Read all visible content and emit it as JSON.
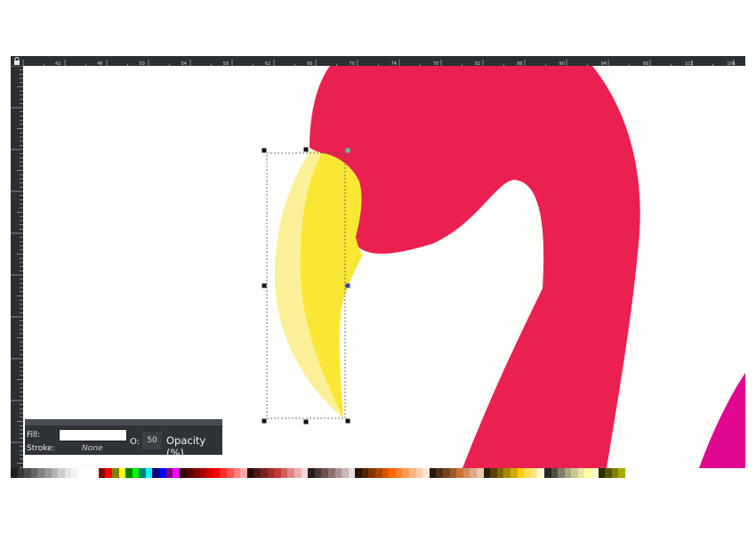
{
  "ruler": {
    "horizontal_labels": [
      "42",
      "46",
      "50",
      "54",
      "58",
      "62",
      "66",
      "70",
      "74",
      "78",
      "82",
      "86",
      "90",
      "94",
      "98",
      "102",
      "106"
    ]
  },
  "canvas": {
    "colors": {
      "background": "#fdfdfb",
      "neck": "#ea2150",
      "beak_yellow": "#f9e736",
      "beak_highlight": "#fbf098",
      "magenta": "#e0068f",
      "selection_handle": "#111111",
      "rotation_handle": "#5ac6a4"
    }
  },
  "palette": {
    "colors": [
      "#1e1e1e",
      "#383838",
      "#4d4d4d",
      "#666666",
      "#808080",
      "#999999",
      "#b3b3b3",
      "#cccccc",
      "#e6e6e6",
      "#f2f2f2",
      "#ffffff",
      "#ffffff",
      "#ffffff",
      "#800000",
      "#ff0000",
      "#808000",
      "#ffff00",
      "#008000",
      "#00ff00",
      "#008080",
      "#00ffff",
      "#000080",
      "#0000ff",
      "#800080",
      "#ff00ff",
      "#2b0000",
      "#550000",
      "#800000",
      "#aa0000",
      "#d40000",
      "#ff0000",
      "#ff2a2a",
      "#ff5555",
      "#ff8080",
      "#ffaaaa",
      "#280b0b",
      "#501616",
      "#782121",
      "#a02c2c",
      "#c83737",
      "#d35f5f",
      "#de8787",
      "#e9afaf",
      "#f4d7d7",
      "#241c1c",
      "#483737",
      "#6c5353",
      "#916f6f",
      "#ac9393",
      "#c8b7b7",
      "#e3dbdb",
      "#2b1100",
      "#552200",
      "#803300",
      "#aa4400",
      "#d45500",
      "#ff6600",
      "#ff7f2a",
      "#ff9955",
      "#ffb380",
      "#ffccaa",
      "#ffe6d5",
      "#28170b",
      "#502d16",
      "#784421",
      "#a05a2c",
      "#c87137",
      "#d38d5f",
      "#deaa87",
      "#e9c6af",
      "#2b2200",
      "#554400",
      "#806600",
      "#aa8800",
      "#d4aa00",
      "#ffcc00",
      "#ffdd55",
      "#ffe680",
      "#fff6d5",
      "#282828",
      "#504f3c",
      "#7f7f6a",
      "#a8a782",
      "#cac88d",
      "#e6e4a9",
      "#ffff99",
      "#ffffcc",
      "#2b2b00",
      "#555500",
      "#808000",
      "#aaaa00"
    ]
  },
  "fill_stroke": {
    "fill_label": "Fill:",
    "fill_color": "#ffffff",
    "stroke_label": "Stroke:",
    "stroke_value": "None",
    "o_label": "O:",
    "o_value": "50",
    "opacity_label": "Opacity (%)"
  }
}
